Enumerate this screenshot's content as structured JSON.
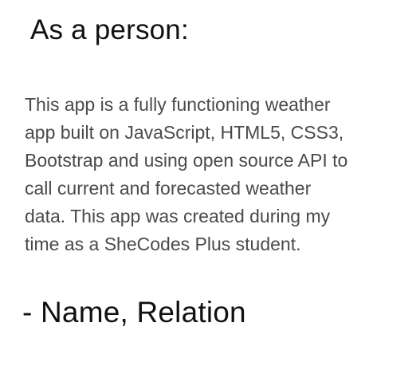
{
  "testimonial": {
    "heading": "As a person:",
    "body_lines": [
      "This app is a fully functioning weather",
      "app built on JavaScript, HTML5, CSS3,",
      "Bootstrap and using open source API to",
      "call current and forecasted weather",
      "data. This app was created during my",
      "time as a SheCodes Plus student."
    ],
    "attribution": "- Name, Relation"
  }
}
